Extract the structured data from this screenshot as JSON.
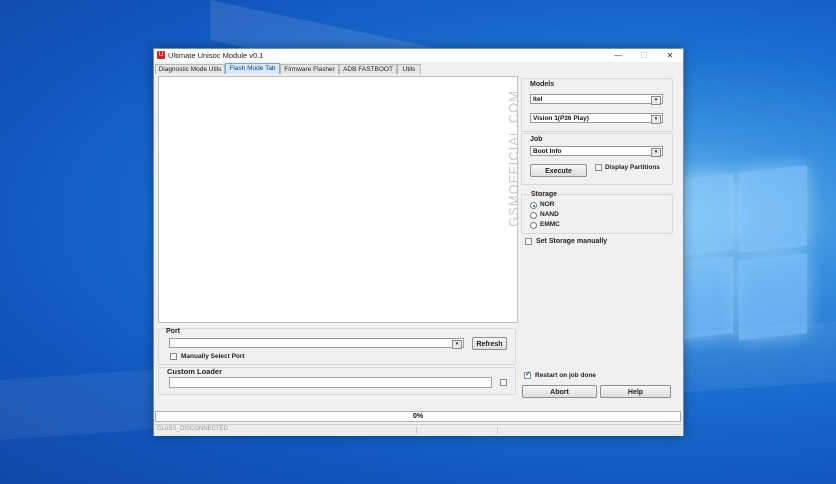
{
  "window": {
    "title": "Ultimate Unisoc Module v0.1",
    "icon": "U"
  },
  "window_controls": {
    "minimize": "—",
    "maximize": "☐",
    "close": "✕"
  },
  "tabs": [
    {
      "label": "Diagnostic Mode Utils",
      "active": false
    },
    {
      "label": "Flash Mode Tab",
      "active": true
    },
    {
      "label": "Firmware Flasher",
      "active": false
    },
    {
      "label": "ADB FASTBOOT",
      "active": false
    },
    {
      "label": "Utils",
      "active": false
    }
  ],
  "watermark": "GSMOFFICIAL.COM",
  "models": {
    "title": "Models",
    "brand": "Itel",
    "model": "Vision 1(P36 Play)"
  },
  "job": {
    "title": "Job",
    "selected": "Boot Info",
    "execute": "Execute",
    "display_partitions": "Display Partitions"
  },
  "storage": {
    "title": "Storage",
    "options": [
      {
        "label": "NOR",
        "selected": true
      },
      {
        "label": "NAND",
        "selected": false
      },
      {
        "label": "EMMC",
        "selected": false
      }
    ],
    "set_manually": "Set Storage manually"
  },
  "port": {
    "title": "Port",
    "value": "",
    "refresh": "Refresh",
    "manual": "Manually Select Port"
  },
  "custom_loader": {
    "title": "Custom Loader",
    "value": ""
  },
  "restart": {
    "label": "Restart on job done",
    "checked": true
  },
  "actions": {
    "abort": "Abort",
    "help": "Help"
  },
  "progress": {
    "text": "0%",
    "value": 0
  },
  "status": {
    "text": "CLASS_DISCONNECTED"
  },
  "icons": {
    "dropdown": "▾",
    "check": "✓"
  },
  "colors": {
    "active_tab": "#d7e9fb",
    "desktop": "#1b6fd0"
  }
}
